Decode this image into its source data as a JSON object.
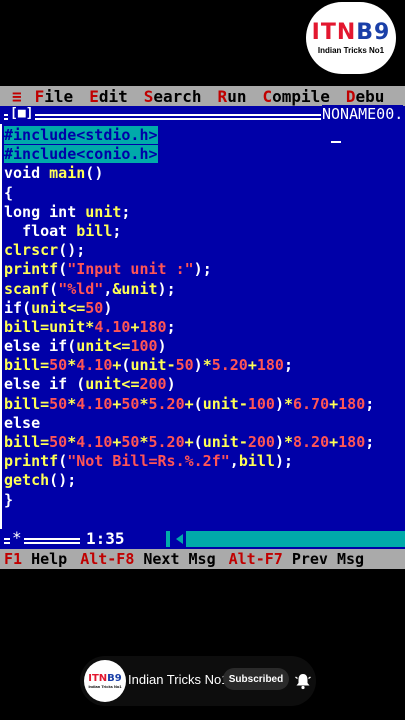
{
  "watermark": {
    "mark_red": "ITN",
    "mark_blue": "B9",
    "subtitle": "Indian Tricks No1"
  },
  "menu": {
    "system": "≡",
    "items": [
      {
        "hotkey": "F",
        "rest": "ile"
      },
      {
        "hotkey": "E",
        "rest": "dit"
      },
      {
        "hotkey": "S",
        "rest": "earch"
      },
      {
        "hotkey": "R",
        "rest": "un"
      },
      {
        "hotkey": "C",
        "rest": "ompile"
      },
      {
        "hotkey": "D",
        "rest": "ebu"
      }
    ]
  },
  "window": {
    "close_box": "[■]",
    "filename": "NONAME00."
  },
  "code_lines": [
    "#include<stdio.h>",
    "#include<conio.h>",
    "void main()",
    "{",
    "long int unit;",
    "  float bill;",
    "clrscr();",
    "printf(\"Input unit :\");",
    "scanf(\"%ld\",&unit);",
    "if(unit<=50)",
    "bill=unit*4.10+180;",
    "else if(unit<=100)",
    "bill=50*4.10+(unit-50)*5.20+180;",
    "else if (unit<=200)",
    "bill=50*4.10+50*5.20+(unit-100)*6.70+180;",
    "else",
    "bill=50*4.10+50*5.20+(unit-200)*8.20+180;",
    "printf(\"Not Bill=Rs.%.2f\",bill);",
    "getch();",
    "}"
  ],
  "status": {
    "modified_marker": "*",
    "cursor_pos": "1:35"
  },
  "hints": [
    {
      "key": "F1",
      "label": "Help"
    },
    {
      "key": "Alt-F8",
      "label": "Next Msg"
    },
    {
      "key": "Alt-F7",
      "label": "Prev Msg"
    }
  ],
  "subscribe_bar": {
    "avatar_mark_red": "ITN",
    "avatar_mark_blue": "B9",
    "avatar_sub": "Indian Tricks No1",
    "channel_name": "Indian Tricks No1",
    "button_label": "Subscribed"
  },
  "colors": {
    "editor_bg": "#0000a8",
    "menu_bg": "#aaaaaa",
    "hotkey": "#c00000",
    "string": "#ff5555",
    "identifier": "#ffff55",
    "selection": "#00aaaa"
  }
}
